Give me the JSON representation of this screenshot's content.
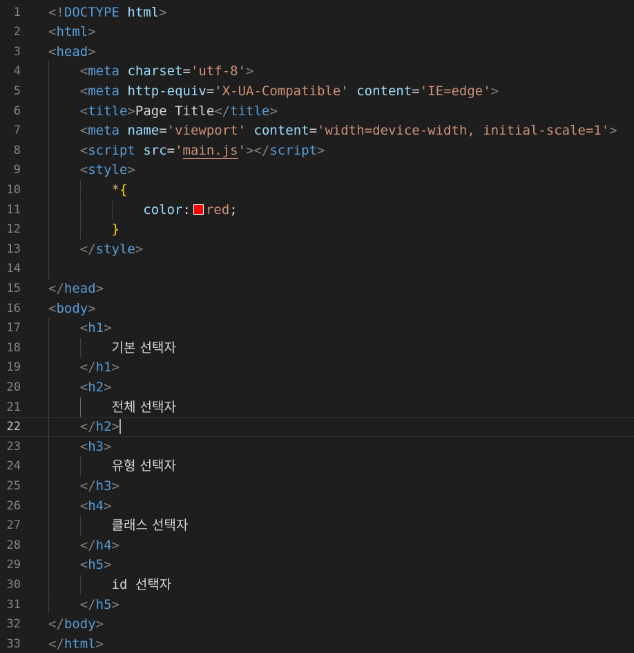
{
  "editor": {
    "language": "html",
    "current_line": 22,
    "lines": [
      {
        "n": "1",
        "parts": [
          [
            "p",
            "<!"
          ],
          [
            "t",
            "DOCTYPE"
          ],
          [
            "w",
            " "
          ],
          [
            "a",
            "html"
          ],
          [
            "p",
            ">"
          ]
        ]
      },
      {
        "n": "2",
        "parts": [
          [
            "p",
            "<"
          ],
          [
            "t",
            "html"
          ],
          [
            "p",
            ">"
          ]
        ]
      },
      {
        "n": "3",
        "parts": [
          [
            "p",
            "<"
          ],
          [
            "t",
            "head"
          ],
          [
            "p",
            ">"
          ]
        ]
      },
      {
        "n": "4",
        "parts": [
          [
            "w",
            "    "
          ],
          [
            "p",
            "<"
          ],
          [
            "t",
            "meta"
          ],
          [
            "w",
            " "
          ],
          [
            "a",
            "charset"
          ],
          [
            "w",
            "="
          ],
          [
            "s",
            "'utf-8'"
          ],
          [
            "p",
            ">"
          ]
        ]
      },
      {
        "n": "5",
        "parts": [
          [
            "w",
            "    "
          ],
          [
            "p",
            "<"
          ],
          [
            "t",
            "meta"
          ],
          [
            "w",
            " "
          ],
          [
            "a",
            "http-equiv"
          ],
          [
            "w",
            "="
          ],
          [
            "s",
            "'X-UA-Compatible'"
          ],
          [
            "w",
            " "
          ],
          [
            "a",
            "content"
          ],
          [
            "w",
            "="
          ],
          [
            "s",
            "'IE=edge'"
          ],
          [
            "p",
            ">"
          ]
        ]
      },
      {
        "n": "6",
        "parts": [
          [
            "w",
            "    "
          ],
          [
            "p",
            "<"
          ],
          [
            "t",
            "title"
          ],
          [
            "p",
            ">"
          ],
          [
            "w",
            "Page Title"
          ],
          [
            "p",
            "</"
          ],
          [
            "t",
            "title"
          ],
          [
            "p",
            ">"
          ]
        ]
      },
      {
        "n": "7",
        "parts": [
          [
            "w",
            "    "
          ],
          [
            "p",
            "<"
          ],
          [
            "t",
            "meta"
          ],
          [
            "w",
            " "
          ],
          [
            "a",
            "name"
          ],
          [
            "w",
            "="
          ],
          [
            "s",
            "'viewport'"
          ],
          [
            "w",
            " "
          ],
          [
            "a",
            "content"
          ],
          [
            "w",
            "="
          ],
          [
            "s",
            "'width=device-width, initial-scale=1'"
          ],
          [
            "p",
            ">"
          ]
        ]
      },
      {
        "n": "8",
        "parts": [
          [
            "w",
            "    "
          ],
          [
            "p",
            "<"
          ],
          [
            "t",
            "script"
          ],
          [
            "w",
            " "
          ],
          [
            "a",
            "src"
          ],
          [
            "w",
            "="
          ],
          [
            "s",
            "'"
          ],
          [
            "squig",
            "main.js"
          ],
          [
            "s",
            "'"
          ],
          [
            "p",
            "></"
          ],
          [
            "t",
            "script"
          ],
          [
            "p",
            ">"
          ]
        ]
      },
      {
        "n": "9",
        "parts": [
          [
            "w",
            "    "
          ],
          [
            "p",
            "<"
          ],
          [
            "t",
            "style"
          ],
          [
            "p",
            ">"
          ]
        ]
      },
      {
        "n": "10",
        "parts": [
          [
            "w",
            "        "
          ],
          [
            "sel",
            "*"
          ],
          [
            "br",
            "{"
          ]
        ]
      },
      {
        "n": "11",
        "parts": [
          [
            "w",
            "            "
          ],
          [
            "prop",
            "color"
          ],
          [
            "w",
            ":"
          ],
          [
            "swatch",
            ""
          ],
          [
            "val",
            "red"
          ],
          [
            "w",
            ";"
          ]
        ]
      },
      {
        "n": "12",
        "parts": [
          [
            "w",
            "        "
          ],
          [
            "br",
            "}"
          ]
        ]
      },
      {
        "n": "13",
        "parts": [
          [
            "w",
            "    "
          ],
          [
            "p",
            "</"
          ],
          [
            "t",
            "style"
          ],
          [
            "p",
            ">"
          ]
        ]
      },
      {
        "n": "14",
        "parts": []
      },
      {
        "n": "15",
        "parts": [
          [
            "p",
            "</"
          ],
          [
            "t",
            "head"
          ],
          [
            "p",
            ">"
          ]
        ]
      },
      {
        "n": "16",
        "parts": [
          [
            "p",
            "<"
          ],
          [
            "t",
            "body"
          ],
          [
            "p",
            ">"
          ]
        ]
      },
      {
        "n": "17",
        "parts": [
          [
            "w",
            "    "
          ],
          [
            "p",
            "<"
          ],
          [
            "t",
            "h1"
          ],
          [
            "p",
            ">"
          ]
        ]
      },
      {
        "n": "18",
        "parts": [
          [
            "w",
            "        "
          ],
          [
            "kr",
            "기본 선택자"
          ]
        ]
      },
      {
        "n": "19",
        "parts": [
          [
            "w",
            "    "
          ],
          [
            "p",
            "</"
          ],
          [
            "t",
            "h1"
          ],
          [
            "p",
            ">"
          ]
        ]
      },
      {
        "n": "20",
        "parts": [
          [
            "w",
            "    "
          ],
          [
            "p",
            "<"
          ],
          [
            "t",
            "h2"
          ],
          [
            "p",
            ">"
          ]
        ]
      },
      {
        "n": "21",
        "parts": [
          [
            "w",
            "        "
          ],
          [
            "kr",
            "전체 선택자"
          ]
        ]
      },
      {
        "n": "22",
        "parts": [
          [
            "w",
            "    "
          ],
          [
            "p",
            "</"
          ],
          [
            "t",
            "h2"
          ],
          [
            "p",
            ">"
          ],
          [
            "cursor",
            ""
          ]
        ]
      },
      {
        "n": "23",
        "parts": [
          [
            "w",
            "    "
          ],
          [
            "p",
            "<"
          ],
          [
            "t",
            "h3"
          ],
          [
            "p",
            ">"
          ]
        ]
      },
      {
        "n": "24",
        "parts": [
          [
            "w",
            "        "
          ],
          [
            "kr",
            "유형 선택자"
          ]
        ]
      },
      {
        "n": "25",
        "parts": [
          [
            "w",
            "    "
          ],
          [
            "p",
            "</"
          ],
          [
            "t",
            "h3"
          ],
          [
            "p",
            ">"
          ]
        ]
      },
      {
        "n": "26",
        "parts": [
          [
            "w",
            "    "
          ],
          [
            "p",
            "<"
          ],
          [
            "t",
            "h4"
          ],
          [
            "p",
            ">"
          ]
        ]
      },
      {
        "n": "27",
        "parts": [
          [
            "w",
            "        "
          ],
          [
            "kr",
            "클래스 선택자"
          ]
        ]
      },
      {
        "n": "28",
        "parts": [
          [
            "w",
            "    "
          ],
          [
            "p",
            "</"
          ],
          [
            "t",
            "h4"
          ],
          [
            "p",
            ">"
          ]
        ]
      },
      {
        "n": "29",
        "parts": [
          [
            "w",
            "    "
          ],
          [
            "p",
            "<"
          ],
          [
            "t",
            "h5"
          ],
          [
            "p",
            ">"
          ]
        ]
      },
      {
        "n": "30",
        "parts": [
          [
            "w",
            "        "
          ],
          [
            "w",
            "id "
          ],
          [
            "kr",
            "선택자"
          ]
        ]
      },
      {
        "n": "31",
        "parts": [
          [
            "w",
            "    "
          ],
          [
            "p",
            "</"
          ],
          [
            "t",
            "h5"
          ],
          [
            "p",
            ">"
          ]
        ]
      },
      {
        "n": "32",
        "parts": [
          [
            "p",
            "</"
          ],
          [
            "t",
            "body"
          ],
          [
            "p",
            ">"
          ]
        ]
      },
      {
        "n": "33",
        "parts": [
          [
            "p",
            "</"
          ],
          [
            "t",
            "html"
          ],
          [
            "p",
            ">"
          ]
        ]
      }
    ],
    "swatch_color": "#ff0000",
    "colors": {
      "background": "#1e1e1e",
      "tag": "#569cd6",
      "attribute": "#9cdcfe",
      "string": "#ce9178",
      "punctuation": "#808080",
      "selector": "#d7ba7d",
      "brace": "#ffd700",
      "line_number": "#858585"
    }
  }
}
